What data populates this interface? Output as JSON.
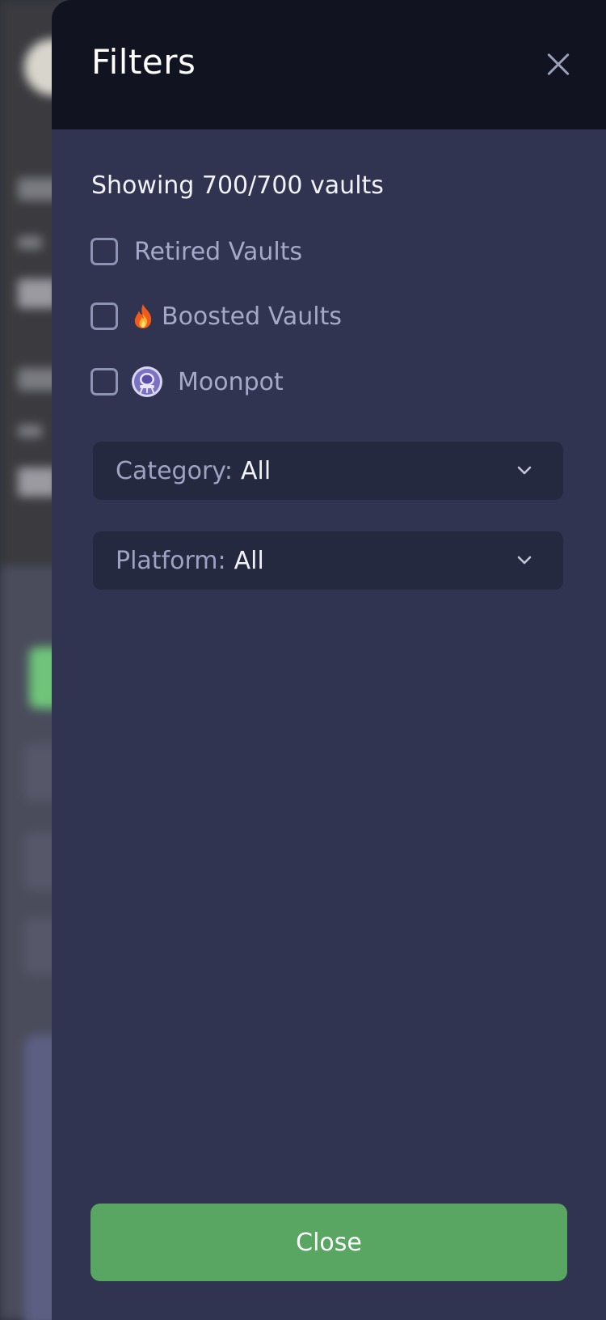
{
  "drawer": {
    "title": "Filters",
    "count_text": "Showing 700/700 vaults",
    "checkboxes": [
      {
        "label": "Retired Vaults",
        "icon": "",
        "checked": false
      },
      {
        "label": "Boosted Vaults",
        "icon": "fire-icon",
        "checked": false
      },
      {
        "label": "Moonpot",
        "icon": "moonpot-icon",
        "checked": false
      }
    ],
    "selects": [
      {
        "label": "Category:",
        "value": "All"
      },
      {
        "label": "Platform:",
        "value": "All"
      }
    ],
    "close_button_label": "Close"
  },
  "colors": {
    "header_bg": "#111321",
    "panel_bg": "#303450",
    "select_bg": "#252940",
    "close_button_bg": "#59a662"
  }
}
